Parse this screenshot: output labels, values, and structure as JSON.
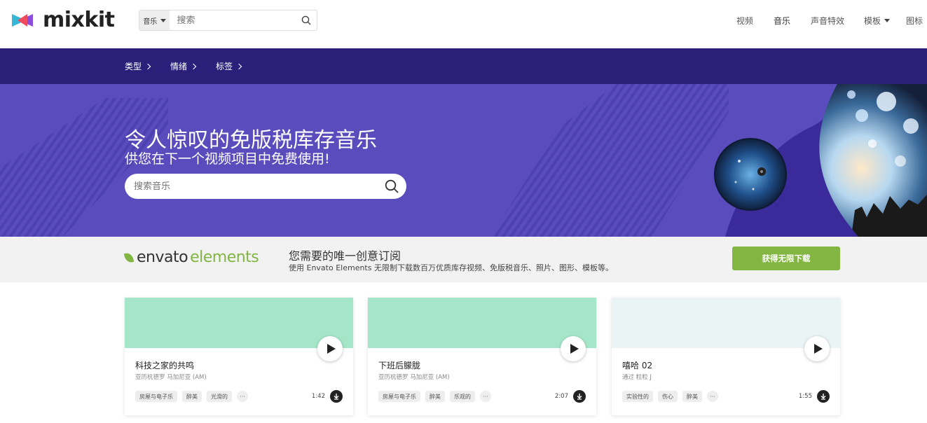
{
  "header": {
    "logo_text": "mixkit",
    "search_type": "音乐",
    "search_placeholder": "搜索",
    "nav": [
      {
        "label": "视频"
      },
      {
        "label": "音乐"
      },
      {
        "label": "声音特效"
      },
      {
        "label": "模板"
      },
      {
        "label": "图标"
      }
    ]
  },
  "category_bar": {
    "items": [
      {
        "label": "类型"
      },
      {
        "label": "情绪"
      },
      {
        "label": "标签"
      }
    ]
  },
  "hero": {
    "title": "令人惊叹的免版税库存音乐",
    "subtitle": "供您在下一个视频项目中免费使用!",
    "search_placeholder": "搜索音乐"
  },
  "envato": {
    "logo_word": "envato",
    "logo_suffix": "elements",
    "heading": "您需要的唯一创意订阅",
    "description": "使用 Envato Elements 无限制下载数百万优质库存视频、免版税音乐、照片、图形、模板等。",
    "cta": "获得无限下载"
  },
  "tracks": [
    {
      "title": "科技之家的共鸣",
      "artist": "亚历杭德罗 马加尼亚 (AM)",
      "tags": [
        "房屋与电子乐",
        "醉美",
        "光滑的"
      ],
      "duration": "1:42",
      "color": "#a6e6c8"
    },
    {
      "title": "下班后朦胧",
      "artist": "亚历杭德罗 马加尼亚 (AM)",
      "tags": [
        "房屋与电子乐",
        "醉美",
        "乐观的"
      ],
      "duration": "2:07",
      "color": "#a6e6c8"
    },
    {
      "title": "嘻哈 02",
      "artist": "通过 粒粒 J",
      "tags": [
        "实验性的",
        "伤心",
        "醉美"
      ],
      "duration": "1:55",
      "color": "#eaf4f5"
    }
  ],
  "colors": {
    "category_bar": "#2c1f7a",
    "hero": "#5a4cbc",
    "envato_green": "#82b541"
  }
}
